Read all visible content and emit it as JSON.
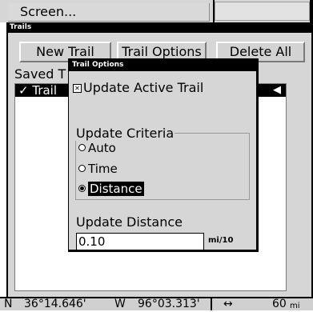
{
  "top_menu": {
    "screen_label": "Screen..."
  },
  "trails_window": {
    "title": "Trails",
    "buttons": {
      "new_trail": "New Trail",
      "trail_options": "Trail Options",
      "delete_all": "Delete All"
    },
    "saved_label": "Saved T",
    "list": [
      {
        "check": "✓",
        "name": "Trail",
        "arrow": "◀"
      }
    ]
  },
  "trail_options_dialog": {
    "title": "Trail Options",
    "update_active_trail": {
      "label": "Update Active Trail",
      "checked": true,
      "mark": "✕"
    },
    "update_criteria": {
      "legend": "Update Criteria",
      "options": [
        {
          "label": "Auto",
          "selected": false
        },
        {
          "label": "Time",
          "selected": false
        },
        {
          "label": "Distance",
          "selected": true
        }
      ]
    },
    "update_distance": {
      "label": "Update Distance",
      "value": "0.10",
      "unit": "mi/10"
    }
  },
  "status_bar": {
    "lat_hemisphere": "N",
    "lat": "36°14.646'",
    "lon_hemisphere": "W",
    "lon": "96°03.313'",
    "zoom_icon": "↔",
    "zoom": "60",
    "zoom_unit": "mi"
  }
}
